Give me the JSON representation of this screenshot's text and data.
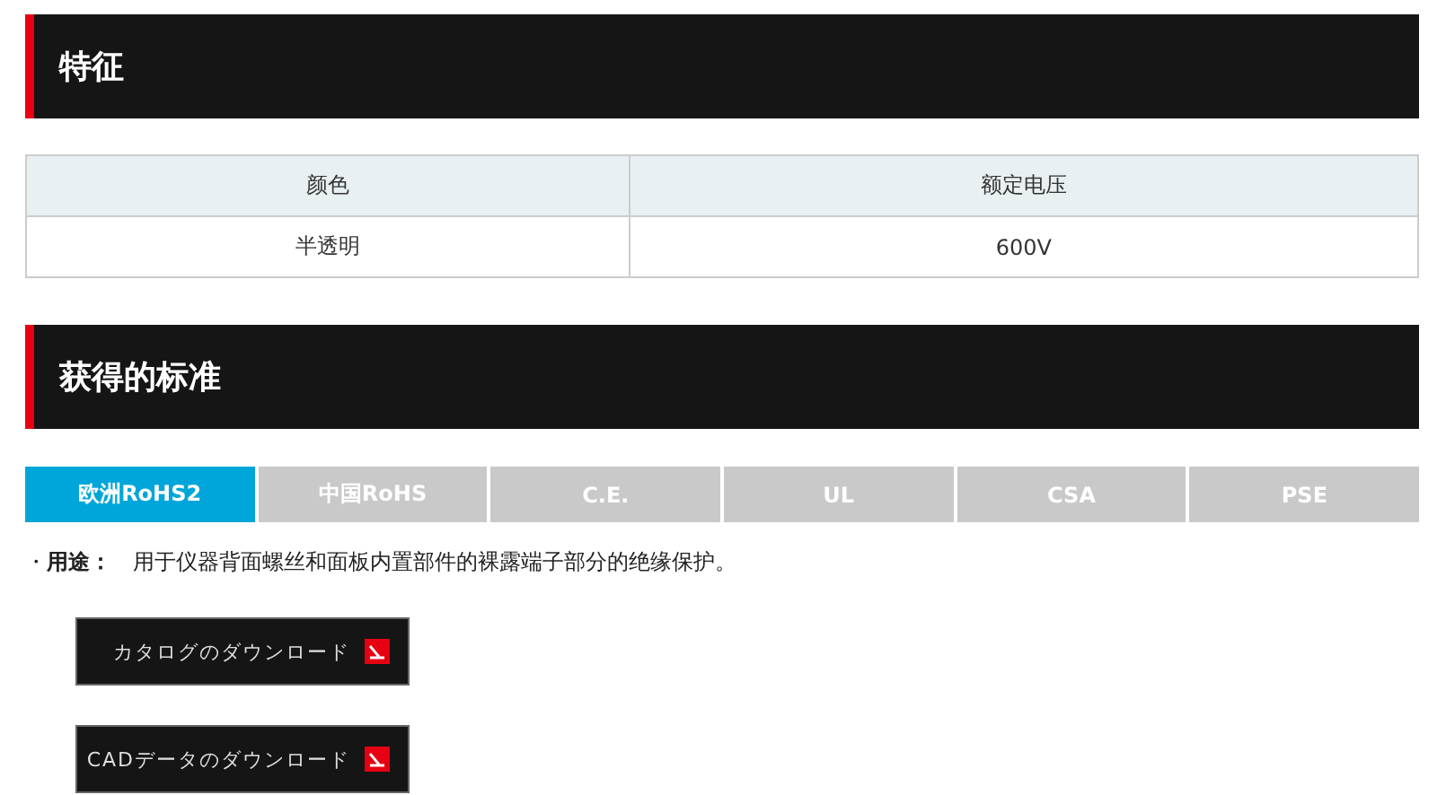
{
  "features": {
    "title": "特征",
    "table": {
      "columns": [
        "颜色",
        "额定电压"
      ],
      "rows": [
        [
          "半透明",
          "600V"
        ]
      ]
    }
  },
  "standards": {
    "title": "获得的标准",
    "tabs": [
      {
        "label": "欧洲RoHS2",
        "selected": true
      },
      {
        "label": "中国RoHS",
        "selected": false
      },
      {
        "label": "C.E.",
        "selected": false
      },
      {
        "label": "UL",
        "selected": false
      },
      {
        "label": "CSA",
        "selected": false
      },
      {
        "label": "PSE",
        "selected": false
      }
    ]
  },
  "usage": {
    "bullet": "・",
    "label": "用途：",
    "text": "用于仪器背面螺丝和面板内置部件的裸露端子部分的绝缘保护。"
  },
  "downloads": [
    "カタログのダウンロード",
    "CADデータのダウンロード"
  ]
}
